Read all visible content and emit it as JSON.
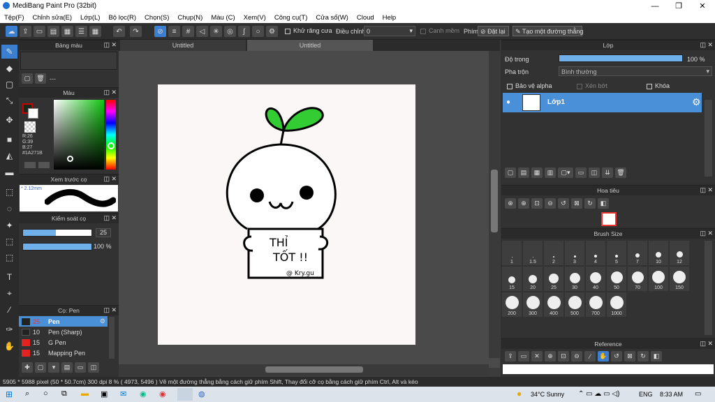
{
  "app": {
    "title": "MediBang Paint Pro (32bit)"
  },
  "window_controls": {
    "minimize": "—",
    "maximize": "❐",
    "close": "✕"
  },
  "menu": [
    "Tệp(F)",
    "Chỉnh sửa(E)",
    "Lớp(L)",
    "Bộ lọc(R)",
    "Chọn(S)",
    "Chụp(N)",
    "Màu (C)",
    "Xem(V)",
    "Công cụ(T)",
    "Cửa sổ(W)",
    "Cloud",
    "Help"
  ],
  "toolbar": {
    "antialias": "Khử răng cưa",
    "adjust_label": "Điều chỉnh",
    "adjust_value": "0",
    "snap": "Canh mềm",
    "key_label": "Phím",
    "set_label": "Đặt lại",
    "straight_line": "Tạo một đường thẳng"
  },
  "panels": {
    "palette": "Bảng màu",
    "palette_text": "---",
    "color": "Màu",
    "rgb": {
      "r": "R:26",
      "g": "G:39",
      "b": "B:27",
      "hex": "#1A271B"
    },
    "brush_preview": "Xem trước cọ",
    "brush_preview_size": "* 2.12mm",
    "brush_control": "Kiểm soát cọ",
    "brush_size": "25",
    "brush_opacity": "100 %",
    "brush_list_title": "Cọ: Pen",
    "brushes": [
      {
        "size": "25",
        "name": "Pen"
      },
      {
        "size": "10",
        "name": "Pen (Sharp)"
      },
      {
        "size": "15",
        "name": "G Pen"
      },
      {
        "size": "15",
        "name": "Mapping Pen"
      }
    ]
  },
  "tabs": [
    "Untitled",
    "Untitled"
  ],
  "canvas_text": {
    "line1": "THỈ",
    "line2": "TỐT !!",
    "signature": "@ Kry.gu"
  },
  "layer": {
    "title": "Lớp",
    "opacity_label": "Độ trong",
    "opacity_value": "100 %",
    "opacity": 1.0,
    "blend_label": "Pha trộn",
    "blend_value": "Bình thường",
    "protect_alpha": "Bảo vệ alpha",
    "clip": "Xén bớt",
    "lock": "Khóa",
    "layer_name": "Lớp1"
  },
  "navigator": {
    "title": "Hoa tiêu"
  },
  "brush_size": {
    "title": "Brush Size",
    "sizes": [
      "1",
      "1.5",
      "2",
      "3",
      "4",
      "5",
      "7",
      "10",
      "12",
      "15",
      "20",
      "25",
      "30",
      "40",
      "50",
      "70",
      "100",
      "150",
      "200",
      "300",
      "400",
      "500",
      "700",
      "1000"
    ]
  },
  "reference": {
    "title": "Reference"
  },
  "status": {
    "text": "5905 * 5988 pixel  (50 * 50.7cm)  300 dpi   8 %  ( 4973, 5496 )  Vẽ một đường thẳng bằng cách giữ phím Shift, Thay đổi cỡ cọ bằng cách giữ phím Ctrl, Alt và kéo"
  },
  "taskbar": {
    "weather": "34°C  Sunny",
    "lang": "ENG",
    "time": "8:33 AM"
  }
}
